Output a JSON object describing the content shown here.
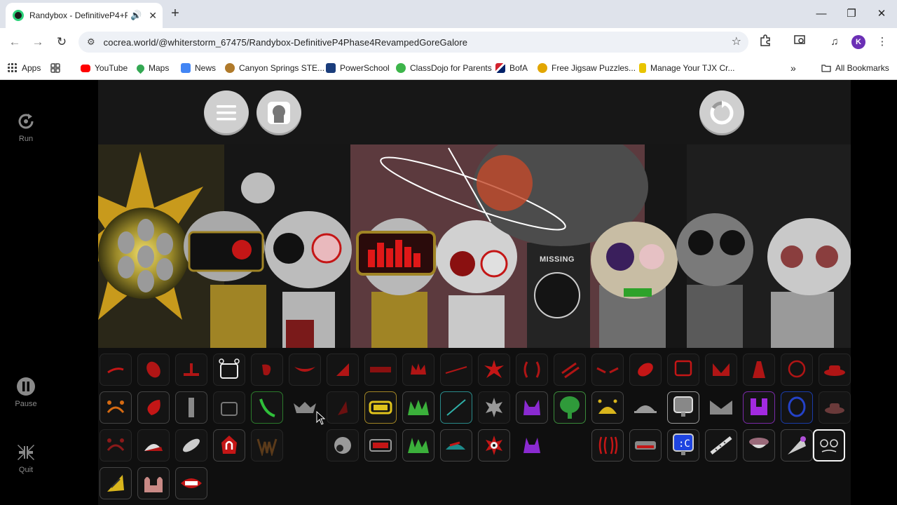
{
  "browser": {
    "tab_title": "Randybox - DefinitiveP4+Pl",
    "url": "cocrea.world/@whiterstorm_67475/Randybox-DefinitiveP4Phase4RevampedGoreGalore",
    "profile_initial": "K",
    "bookmarks": [
      {
        "label": "Apps",
        "icon": "apps-grid-icon",
        "color": "#4285f4"
      },
      {
        "label": "",
        "icon": "tab-groups-icon",
        "color": "#555555"
      },
      {
        "label": "YouTube",
        "icon": "youtube-icon",
        "color": "#ff0000"
      },
      {
        "label": "Maps",
        "icon": "maps-pin-icon",
        "color": "#34a853"
      },
      {
        "label": "News",
        "icon": "news-icon",
        "color": "#4285f4"
      },
      {
        "label": "Canyon Springs STE...",
        "icon": "school-sun-icon",
        "color": "#b07a2a"
      },
      {
        "label": "PowerSchool",
        "icon": "powerschool-icon",
        "color": "#1a3d7c"
      },
      {
        "label": "ClassDojo for Parents",
        "icon": "classdojo-icon",
        "color": "#3db54a"
      },
      {
        "label": "BofA",
        "icon": "bofa-flag-icon",
        "color": "#d2222d"
      },
      {
        "label": "Free Jigsaw Puzzles...",
        "icon": "jigsaw-icon",
        "color": "#e2a600"
      },
      {
        "label": "Manage Your TJX Cr...",
        "icon": "tjx-icon",
        "color": "#e8c400"
      }
    ],
    "all_bookmarks": "All Bookmarks"
  },
  "sidebar": {
    "run": "Run",
    "pause": "Pause",
    "quit": "Quit"
  },
  "scene": {
    "missing_label": "MISSING"
  },
  "colors": {
    "stage_bg": "#0f0f0f",
    "accent_red": "#c41616",
    "button_gray": "#cfcfcf"
  }
}
